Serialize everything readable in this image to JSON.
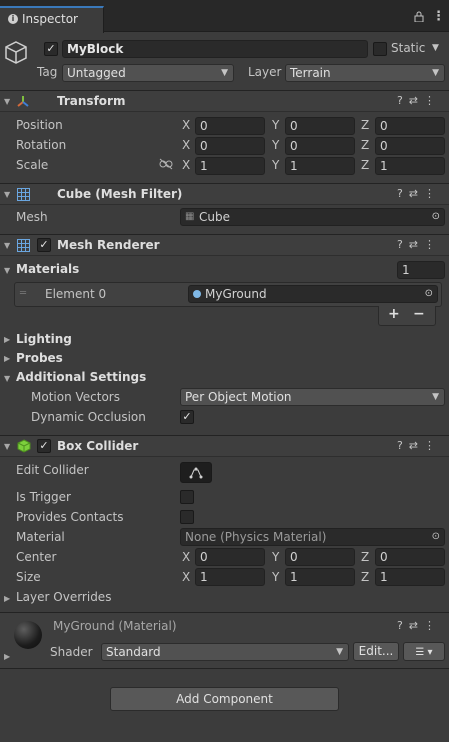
{
  "tab": {
    "title": "Inspector"
  },
  "go": {
    "name": "MyBlock",
    "static_label": "Static",
    "tag_label": "Tag",
    "tag_value": "Untagged",
    "layer_label": "Layer",
    "layer_value": "Terrain"
  },
  "transform": {
    "title": "Transform",
    "position_label": "Position",
    "rotation_label": "Rotation",
    "scale_label": "Scale",
    "position": {
      "x": "0",
      "y": "0",
      "z": "0"
    },
    "rotation": {
      "x": "0",
      "y": "0",
      "z": "0"
    },
    "scale": {
      "x": "1",
      "y": "1",
      "z": "1"
    }
  },
  "axis": {
    "x": "X",
    "y": "Y",
    "z": "Z"
  },
  "mesh_filter": {
    "title": "Cube (Mesh Filter)",
    "mesh_label": "Mesh",
    "mesh_value": "Cube"
  },
  "mesh_renderer": {
    "title": "Mesh Renderer",
    "materials_label": "Materials",
    "materials_count": "1",
    "element_label": "Element 0",
    "element_value": "MyGround",
    "plus": "+",
    "minus": "−",
    "lighting": "Lighting",
    "probes": "Probes",
    "additional": "Additional Settings",
    "motion_vectors_label": "Motion Vectors",
    "motion_vectors_value": "Per Object Motion",
    "dynamic_occlusion_label": "Dynamic Occlusion"
  },
  "box_collider": {
    "title": "Box Collider",
    "edit_collider": "Edit Collider",
    "is_trigger": "Is Trigger",
    "provides_contacts": "Provides Contacts",
    "material_label": "Material",
    "material_value": "None (Physics Material)",
    "center_label": "Center",
    "size_label": "Size",
    "center": {
      "x": "0",
      "y": "0",
      "z": "0"
    },
    "size": {
      "x": "1",
      "y": "1",
      "z": "1"
    },
    "layer_overrides": "Layer Overrides"
  },
  "material": {
    "title": "MyGround (Material)",
    "shader_label": "Shader",
    "shader_value": "Standard",
    "edit_label": "Edit..."
  },
  "add_component": "Add Component"
}
